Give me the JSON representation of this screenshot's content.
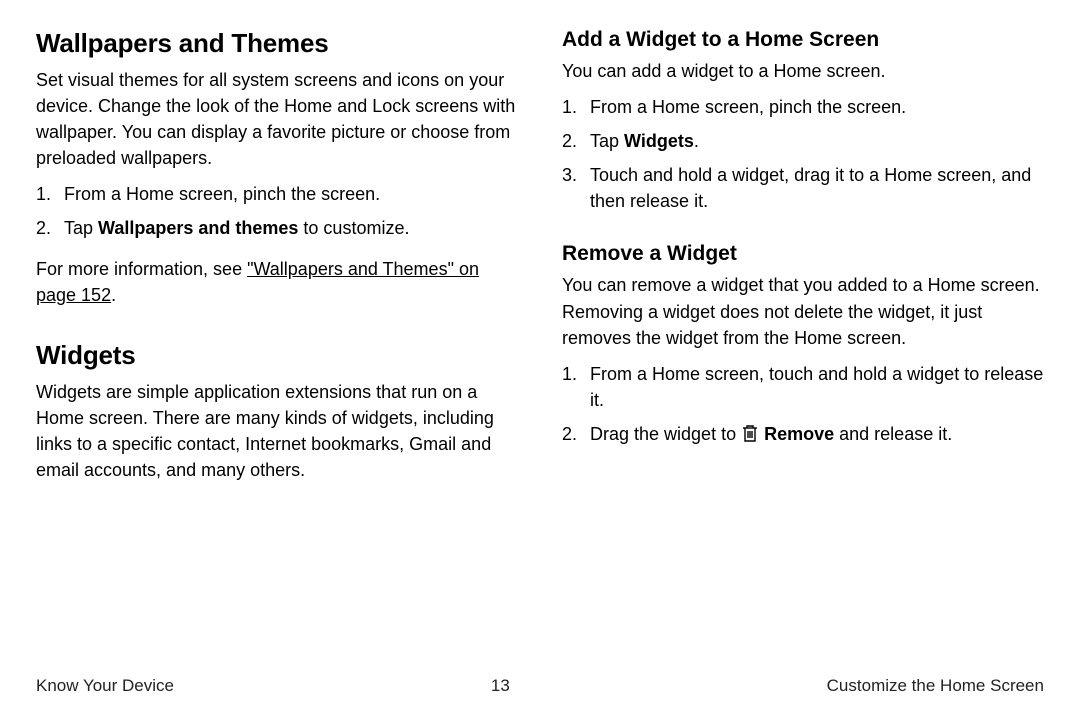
{
  "left": {
    "wallpapers": {
      "heading": "Wallpapers and Themes",
      "intro": "Set visual themes for all system screens and icons on your device. Change the look of the Home and Lock screens with wallpaper. You can display a favorite picture or choose from preloaded wallpapers.",
      "steps": {
        "s1": "From a Home screen, pinch the screen.",
        "s2_prefix": "Tap ",
        "s2_bold": "Wallpapers and themes",
        "s2_suffix": " to customize."
      },
      "crossref_prefix": "For more information, see ",
      "crossref_link": "\"Wallpapers and Themes\" on page 152",
      "crossref_suffix": "."
    },
    "widgets": {
      "heading": "Widgets",
      "intro": "Widgets are simple application extensions that run on a Home screen. There are many kinds of widgets, including links to a specific contact, Internet bookmarks, Gmail and email accounts, and many others."
    }
  },
  "right": {
    "add": {
      "heading": "Add a Widget to a Home Screen",
      "intro": "You can add a widget to a Home screen.",
      "steps": {
        "s1": "From a Home screen, pinch the screen.",
        "s2_prefix": "Tap ",
        "s2_bold": "Widgets",
        "s2_suffix": ".",
        "s3": "Touch and hold a widget, drag it to a Home screen, and then release it."
      }
    },
    "remove": {
      "heading": "Remove a Widget",
      "intro": "You can remove a widget that you added to a Home screen. Removing a widget does not delete the widget, it just removes the widget from the Home screen.",
      "steps": {
        "s1": "From a Home screen, touch and hold a widget to release it.",
        "s2_prefix": "Drag the widget to ",
        "s2_bold": " Remove",
        "s2_suffix": " and release it."
      }
    }
  },
  "footer": {
    "left": "Know Your Device",
    "center": "13",
    "right": "Customize the Home Screen"
  }
}
